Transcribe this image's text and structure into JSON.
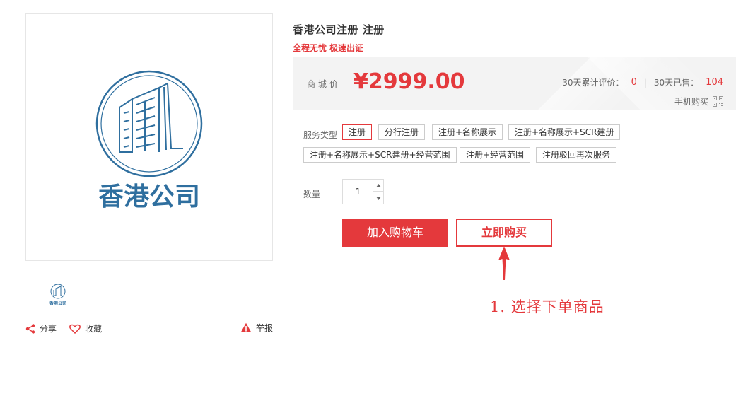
{
  "product": {
    "title": "香港公司注册 注册",
    "subtitle": "全程无忧 极速出证",
    "image_text": "香港公司",
    "thumb_text": "香港公司"
  },
  "price": {
    "label": "商城价",
    "value": "¥2999.00"
  },
  "stats": {
    "reviews_label": "30天累计评价：",
    "reviews_value": "0",
    "sold_label": "30天已售：",
    "sold_value": "104",
    "mobile_buy_label": "手机购买"
  },
  "service": {
    "label": "服务类型",
    "options": [
      "注册",
      "分行注册",
      "注册+名称展示",
      "注册+名称展示+SCR建册",
      "注册+名称展示+SCR建册+经营范围",
      "注册+经营范围",
      "注册驳回再次服务"
    ],
    "selected_index": 0
  },
  "quantity": {
    "label": "数量",
    "value": "1"
  },
  "buttons": {
    "add_to_cart": "加入购物车",
    "buy_now": "立即购买"
  },
  "actions": {
    "share": "分享",
    "favorite": "收藏",
    "report": "举报"
  },
  "annotation": {
    "text": "1. 选择下单商品"
  },
  "colors": {
    "accent": "#e4393c",
    "logo_blue": "#2f6f9f"
  },
  "icons": [
    "share-icon",
    "heart-icon",
    "warning-icon",
    "qr-code-icon",
    "arrow-up-icon"
  ]
}
